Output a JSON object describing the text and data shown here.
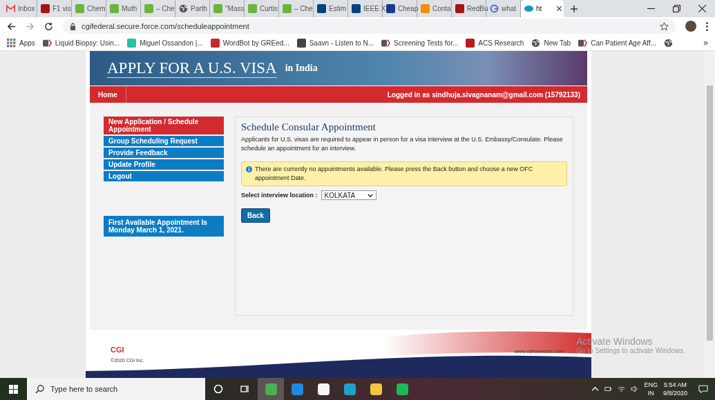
{
  "browser": {
    "tabs": [
      {
        "kind": "mail",
        "label": "Inbox",
        "selected": false
      },
      {
        "kind": "bus",
        "label": "F1 vis",
        "selected": false
      },
      {
        "kind": "sat",
        "label": "Chem",
        "selected": false
      },
      {
        "kind": "sat",
        "label": "Muth",
        "selected": false
      },
      {
        "kind": "sat",
        "label": "– Che",
        "selected": false
      },
      {
        "kind": "globe",
        "label": "Parth",
        "selected": false
      },
      {
        "kind": "sat",
        "label": "\"Mass",
        "selected": false
      },
      {
        "kind": "sat",
        "label": "Curtis",
        "selected": false
      },
      {
        "kind": "sat",
        "label": "– Che",
        "selected": false
      },
      {
        "kind": "ieee",
        "label": "Estim",
        "selected": false
      },
      {
        "kind": "ieee",
        "label": "IEEE X",
        "selected": false
      },
      {
        "kind": "square",
        "label": "Cheap",
        "selected": false
      },
      {
        "kind": "orange",
        "label": "Conta",
        "selected": false
      },
      {
        "kind": "bus",
        "label": "RedBu",
        "selected": false
      },
      {
        "kind": "google",
        "label": "what",
        "selected": false
      },
      {
        "kind": "cloud",
        "label": "ht",
        "selected": true
      }
    ],
    "address": "cgifederal.secure.force.com/scheduleappointment",
    "bookmarks": [
      {
        "kind": "apps",
        "label": "Apps"
      },
      {
        "kind": "doc",
        "label": "Liquid Biopsy: Usin..."
      },
      {
        "kind": "r",
        "label": "Miguel Ossandon |..."
      },
      {
        "kind": "robot",
        "label": "WordBot by GREed..."
      },
      {
        "kind": "saavn",
        "label": "Saavn - Listen to N..."
      },
      {
        "kind": "doc",
        "label": "Screening Tests for..."
      },
      {
        "kind": "acs",
        "label": "ACS Research"
      },
      {
        "kind": "globe",
        "label": "New Tab"
      },
      {
        "kind": "doc",
        "label": "Can Patient Age Aff..."
      },
      {
        "kind": "globe"
      }
    ],
    "more_bookmarks": "»"
  },
  "page": {
    "banner_title": "APPLY FOR A U.S. VISA",
    "banner_subtitle": "in India",
    "nav": {
      "home": "Home",
      "logged_in": "Logged in as  sindhuja.sivagnanam@gmail.com (15792133)"
    },
    "sidebar": {
      "items": [
        {
          "label": "New Application / Schedule Appointment",
          "selected": true
        },
        {
          "label": "Group Scheduling Request",
          "selected": false
        },
        {
          "label": "Provide Feedback",
          "selected": false
        },
        {
          "label": "Update Profile",
          "selected": false
        },
        {
          "label": "Logout",
          "selected": false
        }
      ],
      "notice": "First Available Appointment Is Monday March 1, 2021."
    },
    "main": {
      "title": "Schedule Consular Appointment",
      "intro": "Applicants for U.S. visas are required to appear in person for a visa interview at the U.S. Embassy/Consulate. Please schedule an appointment for an interview.",
      "alert": "There are currently no appointments available. Please press the Back button and choose a new OFC appointment Date.",
      "location_label": "Select interview location :",
      "location_value": "KOLKATA",
      "back_button": "Back"
    },
    "footer": {
      "logo": "CGI",
      "copyright": "©2020 CGI Inc.",
      "website": "www.ustraveldocs.com"
    }
  },
  "activation": {
    "title": "Activate Windows",
    "subtitle": "Go to Settings to activate Windows."
  },
  "taskbar": {
    "search_placeholder": "Type here to search",
    "apps": [
      {
        "kind": "chrome",
        "active": true
      },
      {
        "kind": "mail",
        "active": false
      },
      {
        "kind": "store",
        "active": false
      },
      {
        "kind": "edge",
        "active": false
      },
      {
        "kind": "files",
        "active": false
      },
      {
        "kind": "spotify",
        "active": false
      }
    ],
    "language": "ENG",
    "region": "IN",
    "time": "5:54 AM",
    "date": "9/8/2020"
  }
}
